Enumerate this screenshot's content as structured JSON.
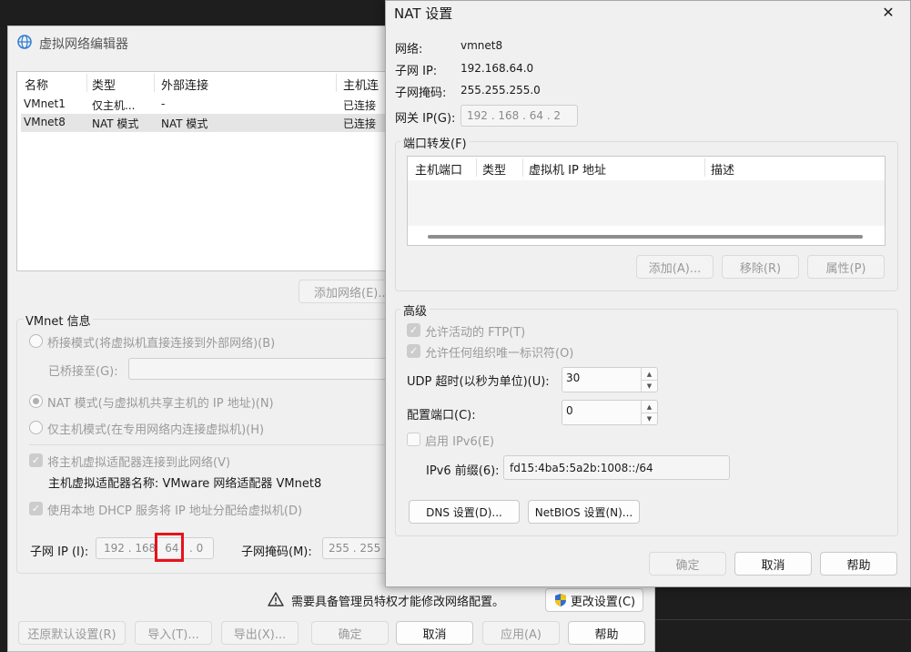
{
  "vne": {
    "title": "虚拟网络编辑器",
    "columns": [
      "名称",
      "类型",
      "外部连接",
      "主机连"
    ],
    "rows": [
      {
        "name": "VMnet1",
        "type": "仅主机...",
        "ext": "-",
        "host": "已连接"
      },
      {
        "name": "VMnet8",
        "type": "NAT 模式",
        "ext": "NAT 模式",
        "host": "已连接"
      }
    ],
    "add_network": "添加网络(E)...",
    "info_title": "VMnet 信息",
    "bridge_mode": "桥接模式(将虚拟机直接连接到外部网络)(B)",
    "bridged_to": "已桥接至(G):",
    "nat_mode": "NAT 模式(与虚拟机共享主机的 IP 地址)(N)",
    "host_only_mode": "仅主机模式(在专用网络内连接虚拟机)(H)",
    "connect_adapter": "将主机虚拟适配器连接到此网络(V)",
    "adapter_name": "主机虚拟适配器名称: VMware 网络适配器 VMnet8",
    "use_dhcp": "使用本地 DHCP 服务将 IP 地址分配给虚拟机(D)",
    "subnet_ip_label": "子网 IP (I):",
    "subnet_ip": {
      "a": "192",
      "b": "168",
      "c": "64",
      "d": "0"
    },
    "subnet_mask_label": "子网掩码(M):",
    "subnet_mask": "255 . 255 .",
    "admin_warning": "需要具备管理员特权才能修改网络配置。",
    "change_settings": "更改设置(C)",
    "restore_defaults": "还原默认设置(R)",
    "import": "导入(T)...",
    "export": "导出(X)...",
    "ok": "确定",
    "cancel": "取消",
    "apply": "应用(A)",
    "help": "帮助"
  },
  "nat": {
    "title": "NAT 设置",
    "network_label": "网络:",
    "network": "vmnet8",
    "subnet_ip_label": "子网 IP:",
    "subnet_ip": "192.168.64.0",
    "subnet_mask_label": "子网掩码:",
    "subnet_mask": "255.255.255.0",
    "gateway_label": "网关 IP(G):",
    "gateway": "192 . 168 . 64 . 2",
    "port_forward_title": "端口转发(F)",
    "pf_columns": [
      "主机端口",
      "类型",
      "虚拟机 IP 地址",
      "描述"
    ],
    "add": "添加(A)...",
    "remove": "移除(R)",
    "properties": "属性(P)",
    "advanced_title": "高级",
    "allow_ftp": "允许活动的 FTP(T)",
    "allow_oui": "允许任何组织唯一标识符(O)",
    "udp_timeout_label": "UDP 超时(以秒为单位)(U):",
    "udp_timeout": "30",
    "config_port_label": "配置端口(C):",
    "config_port": "0",
    "enable_ipv6": "启用 IPv6(E)",
    "ipv6_prefix_label": "IPv6 前缀(6):",
    "ipv6_prefix": "fd15:4ba5:5a2b:1008::/64",
    "dns_settings": "DNS 设置(D)...",
    "netbios_settings": "NetBIOS 设置(N)...",
    "ok": "确定",
    "cancel": "取消",
    "help": "帮助",
    "close": "✕"
  },
  "colors": {
    "highlight_box": "#e8121b",
    "selected_row": "#e5e5e5",
    "accent_globe": "#2b7cd3"
  }
}
